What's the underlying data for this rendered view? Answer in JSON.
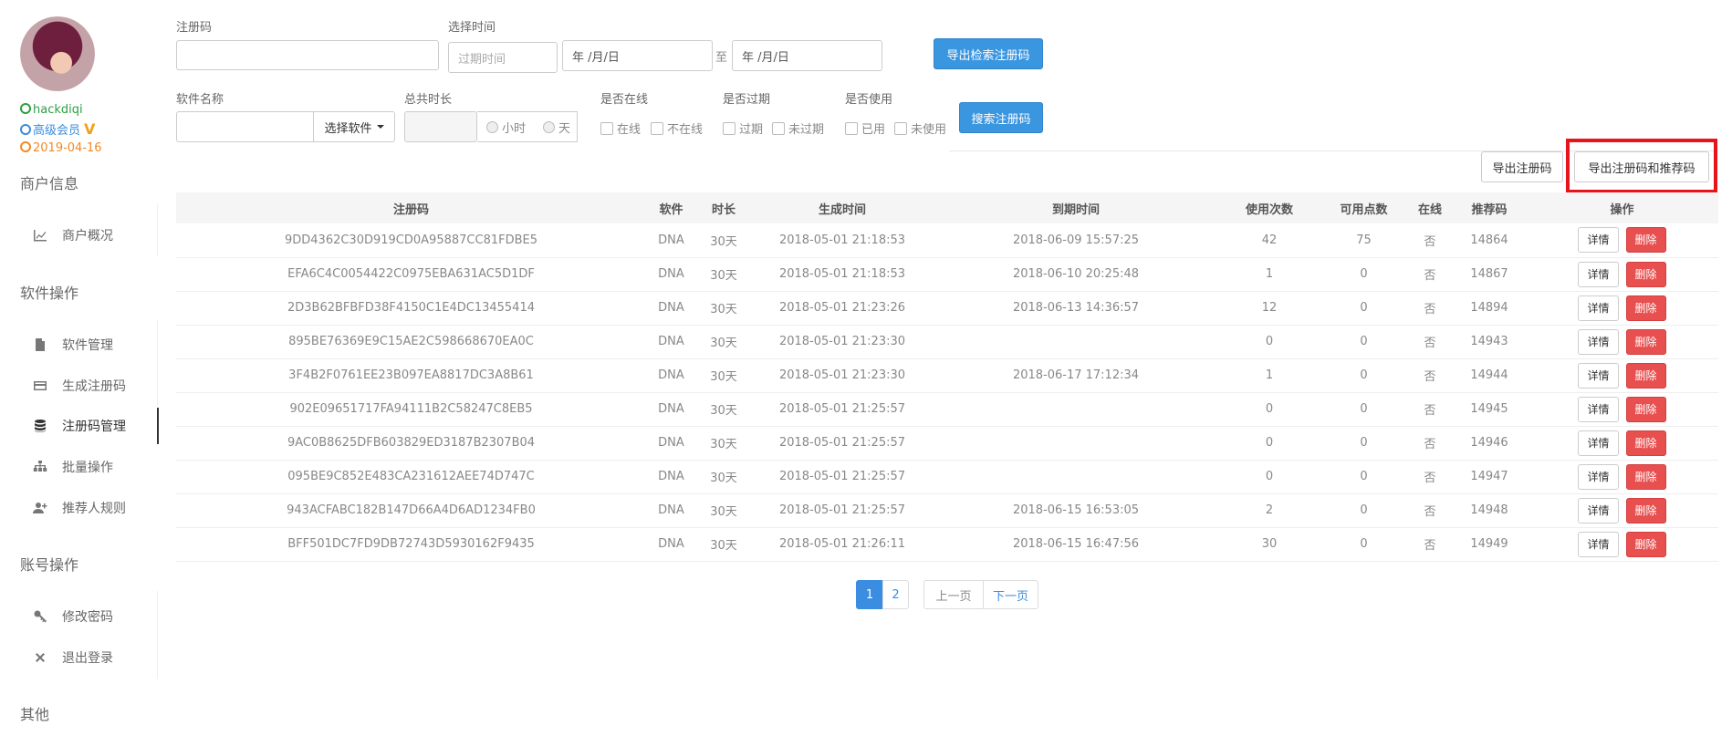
{
  "user": {
    "name": "hackdiqi",
    "level": "高级会员",
    "level_badge": "V",
    "date": "2019-04-16"
  },
  "sidebar": {
    "sections": [
      {
        "title": "商户信息",
        "items": [
          {
            "label": "商户概况",
            "icon": "line-chart-icon"
          }
        ]
      },
      {
        "title": "软件操作",
        "items": [
          {
            "label": "软件管理",
            "icon": "file-icon"
          },
          {
            "label": "生成注册码",
            "icon": "credit-card-icon"
          },
          {
            "label": "注册码管理",
            "icon": "database-icon",
            "active": true
          },
          {
            "label": "批量操作",
            "icon": "sitemap-icon"
          },
          {
            "label": "推荐人规则",
            "icon": "user-plus-icon"
          }
        ]
      },
      {
        "title": "账号操作",
        "items": [
          {
            "label": "修改密码",
            "icon": "key-icon"
          },
          {
            "label": "退出登录",
            "icon": "close-icon"
          }
        ]
      },
      {
        "title": "其他",
        "items": []
      }
    ]
  },
  "filters": {
    "code_label": "注册码",
    "code_value": "",
    "time_label": "选择时间",
    "time_placeholder": "过期时间",
    "date_start": "年 /月/日",
    "date_sep": "至",
    "date_end": "年 /月/日",
    "export_search_button": "导出检索注册码",
    "software_label": "软件名称",
    "software_value": "",
    "select_software_button": "选择软件",
    "duration_label": "总共时长",
    "duration_value": "",
    "unit_hour": "小时",
    "unit_day": "天",
    "online_label": "是否在线",
    "online_yes": "在线",
    "online_no": "不在线",
    "expired_label": "是否过期",
    "expired_yes": "过期",
    "expired_no": "未过期",
    "used_label": "是否使用",
    "used_yes": "已用",
    "used_no": "未使用",
    "search_button": "搜索注册码"
  },
  "toolbar": {
    "export_codes": "导出注册码",
    "export_codes_and_referrers": "导出注册码和推荐码"
  },
  "table": {
    "columns": [
      "注册码",
      "软件",
      "时长",
      "生成时间",
      "到期时间",
      "使用次数",
      "可用点数",
      "在线",
      "推荐码",
      "操作"
    ],
    "detail_label": "详情",
    "delete_label": "删除",
    "rows": [
      [
        "9DD4362C30D919CD0A95887CC81FDBE5",
        "DNA",
        "30天",
        "2018-05-01 21:18:53",
        "2018-06-09 15:57:25",
        "42",
        "75",
        "否",
        "14864"
      ],
      [
        "EFA6C4C0054422C0975EBA631AC5D1DF",
        "DNA",
        "30天",
        "2018-05-01 21:18:53",
        "2018-06-10 20:25:48",
        "1",
        "0",
        "否",
        "14867"
      ],
      [
        "2D3B62BFBFD38F4150C1E4DC13455414",
        "DNA",
        "30天",
        "2018-05-01 21:23:26",
        "2018-06-13 14:36:57",
        "12",
        "0",
        "否",
        "14894"
      ],
      [
        "895BE76369E9C15AE2C598668670EA0C",
        "DNA",
        "30天",
        "2018-05-01 21:23:30",
        "",
        "0",
        "0",
        "否",
        "14943"
      ],
      [
        "3F4B2F0761EE23B097EA8817DC3A8B61",
        "DNA",
        "30天",
        "2018-05-01 21:23:30",
        "2018-06-17 17:12:34",
        "1",
        "0",
        "否",
        "14944"
      ],
      [
        "902E09651717FA94111B2C58247C8EB5",
        "DNA",
        "30天",
        "2018-05-01 21:25:57",
        "",
        "0",
        "0",
        "否",
        "14945"
      ],
      [
        "9AC0B8625DFB603829ED3187B2307B04",
        "DNA",
        "30天",
        "2018-05-01 21:25:57",
        "",
        "0",
        "0",
        "否",
        "14946"
      ],
      [
        "095BE9C852E483CA231612AEE74D747C",
        "DNA",
        "30天",
        "2018-05-01 21:25:57",
        "",
        "0",
        "0",
        "否",
        "14947"
      ],
      [
        "943ACFABC182B147D66A4D6AD1234FB0",
        "DNA",
        "30天",
        "2018-05-01 21:25:57",
        "2018-06-15 16:53:05",
        "2",
        "0",
        "否",
        "14948"
      ],
      [
        "BFF501DC7FD9DB72743D5930162F9435",
        "DNA",
        "30天",
        "2018-05-01 21:26:11",
        "2018-06-15 16:47:56",
        "30",
        "0",
        "否",
        "14949"
      ]
    ]
  },
  "pagination": {
    "pages": [
      "1",
      "2"
    ],
    "current": "1",
    "prev": "上一页",
    "next": "下一页"
  },
  "colors": {
    "primary": "#3b96e0",
    "danger": "#e84f4f",
    "highlight": "#e8141c"
  }
}
